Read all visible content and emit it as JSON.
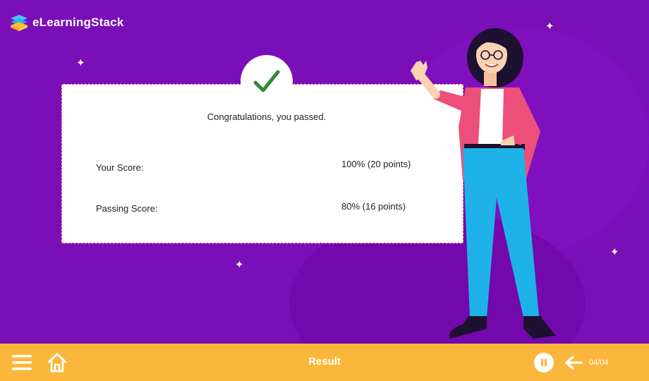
{
  "brand": {
    "name": "eLearningStack"
  },
  "result": {
    "message": "Congratulations, you passed.",
    "rows": [
      {
        "label": "Your Score:",
        "value": "100% (20 points)"
      },
      {
        "label": "Passing Score:",
        "value": "80% (16 points)"
      }
    ]
  },
  "bottombar": {
    "title": "Result",
    "page_indicator": "04/04"
  },
  "icons": {
    "menu": "hamburger-menu-icon",
    "home": "home-icon",
    "pause": "pause-icon",
    "back": "arrow-left-icon",
    "check": "check-icon"
  },
  "colors": {
    "background": "#7a0fb8",
    "bottombar": "#fbb73c",
    "check": "#2e8b2e",
    "card_border": "#e0477a"
  }
}
